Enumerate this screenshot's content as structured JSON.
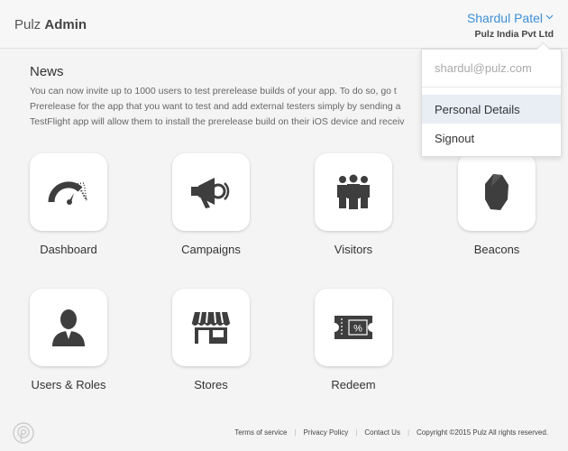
{
  "header": {
    "brand_light": "Pulz",
    "brand_bold": "Admin",
    "user_name": "Shardul Patel",
    "company": "Pulz India Pvt Ltd"
  },
  "user_menu": {
    "email": "shardul@pulz.com",
    "items": [
      "Personal Details",
      "Signout"
    ],
    "highlighted": "Personal Details"
  },
  "news": {
    "title": "News",
    "lines": [
      "You can now invite up to 1000 users to test prerelease builds of your app. To do so, go t",
      "Prerelease for the app that you want to test and add external testers simply by sending a",
      "TestFlight app will allow them to install the prerelease build on their iOS device and receiv"
    ]
  },
  "tiles": [
    {
      "label": "Dashboard",
      "icon": "speedometer-icon"
    },
    {
      "label": "Campaigns",
      "icon": "megaphone-icon"
    },
    {
      "label": "Visitors",
      "icon": "people-icon"
    },
    {
      "label": "Beacons",
      "icon": "beacon-icon"
    },
    {
      "label": "Users & Roles",
      "icon": "user-icon"
    },
    {
      "label": "Stores",
      "icon": "store-icon"
    },
    {
      "label": "Redeem",
      "icon": "ticket-icon"
    }
  ],
  "footer": {
    "links": [
      "Terms of service",
      "Privacy Policy",
      "Contact Us"
    ],
    "copyright": "Copyright ©2015 Pulz All rights reserved."
  }
}
